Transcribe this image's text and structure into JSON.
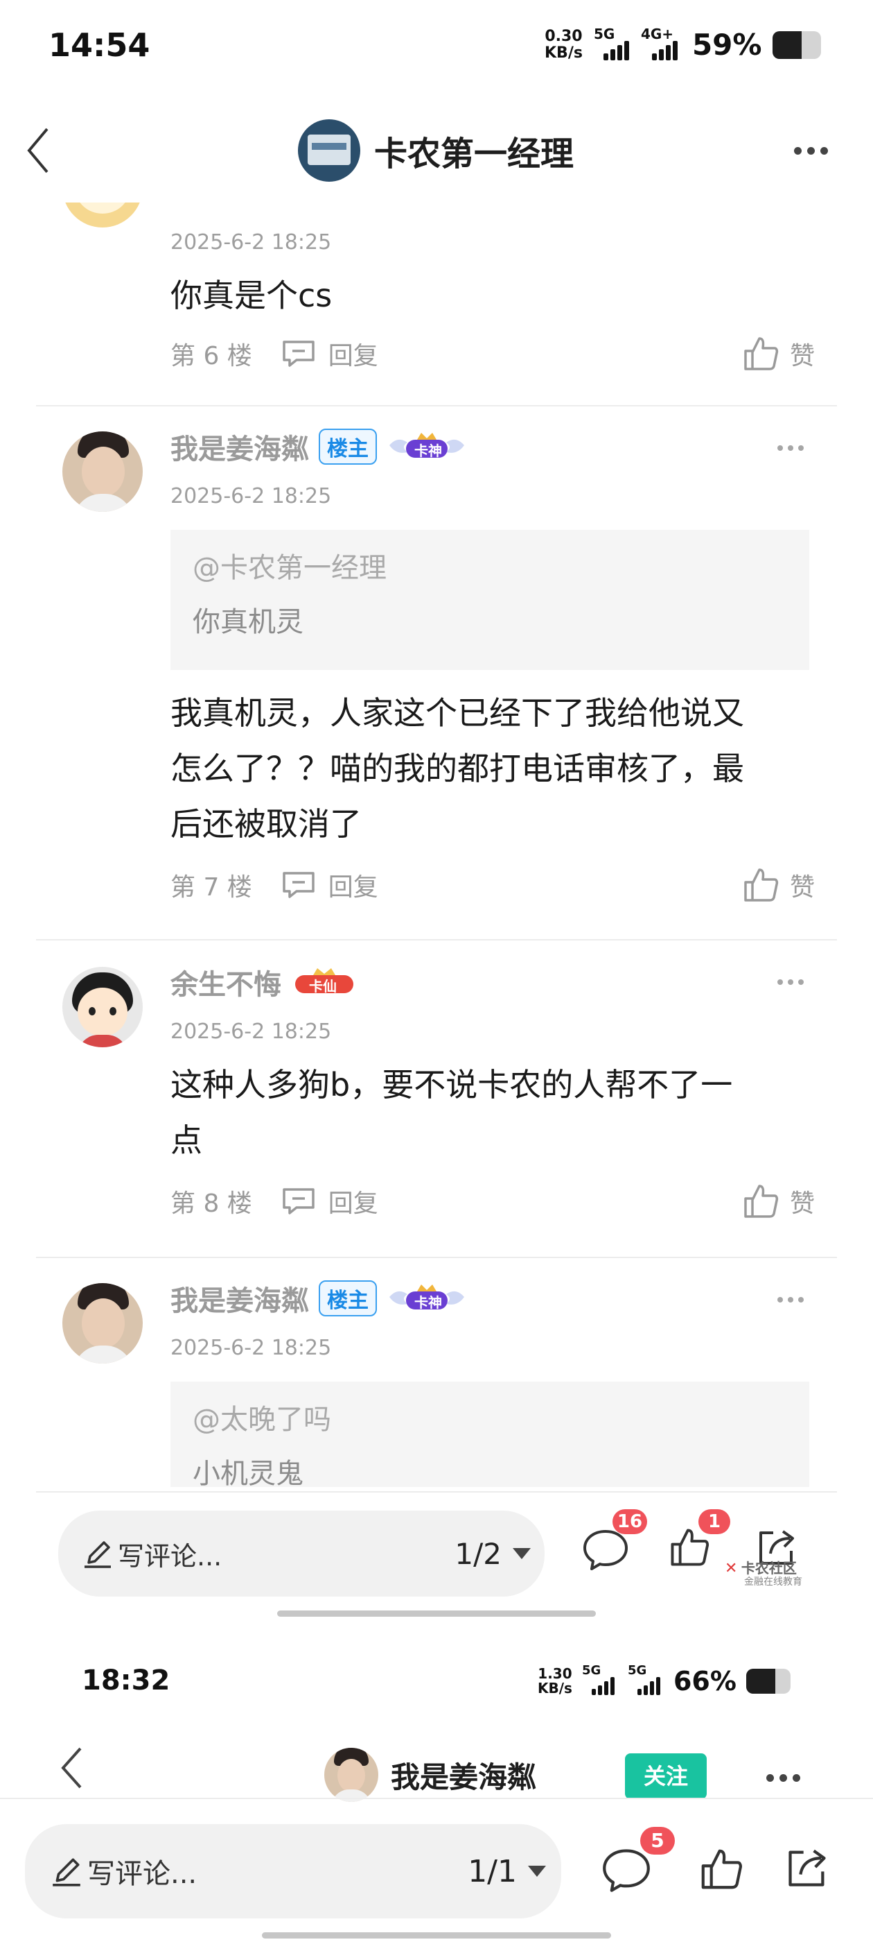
{
  "status_bar_1": {
    "time": "14:54",
    "net_speed": "0.30",
    "net_unit": "KB/s",
    "signal_1": "5G",
    "signal_2": "4G+",
    "battery": "59%",
    "battery_level": 0.59
  },
  "nav_1": {
    "title": "卡农第一经理"
  },
  "comments": [
    {
      "time": "2025-6-2 18:25",
      "body": "你真是个cs",
      "floor": "第 6 楼",
      "reply": "回复",
      "like": "赞"
    },
    {
      "name": "我是姜海粼",
      "op_badge": "楼主",
      "rank_badge": "卡神",
      "time": "2025-6-2 18:25",
      "quote_at": "@卡农第一经理",
      "quote_text": "你真机灵",
      "body_lines": [
        "我真机灵，人家这个已经下了我给他说又",
        "怎么了？？喵的我的都打电话审核了，最",
        "后还被取消了"
      ],
      "floor": "第 7 楼",
      "reply": "回复",
      "like": "赞"
    },
    {
      "name": "余生不悔",
      "rank_badge": "卡仙",
      "time": "2025-6-2 18:25",
      "body_lines": [
        "这种人多狗b，要不说卡农的人帮不了一",
        "点"
      ],
      "floor": "第 8 楼",
      "reply": "回复",
      "like": "赞"
    },
    {
      "name": "我是姜海粼",
      "op_badge": "楼主",
      "rank_badge": "卡神",
      "time": "2025-6-2 18:25",
      "quote_at": "@太晚了吗",
      "quote_text": "小机灵鬼"
    }
  ],
  "comment_bar_1": {
    "write": "写评论...",
    "page": "1/2",
    "comment_count": "16",
    "like_count": "1"
  },
  "watermark": {
    "line1": "卡农社区",
    "line2": "金融在线教育"
  },
  "status_bar_2": {
    "time": "18:32",
    "net_speed": "1.30",
    "net_unit": "KB/s",
    "signal_1": "5G",
    "signal_2": "5G",
    "battery": "66%",
    "battery_level": 0.66
  },
  "nav_2": {
    "title": "我是姜海粼",
    "follow": "关注"
  },
  "comment_bar_2": {
    "write": "写评论...",
    "page": "1/1",
    "comment_count": "5"
  },
  "colors": {
    "accent": "#19c3a0",
    "badge_red": "#f0525a",
    "op_blue": "#1a8ae6"
  }
}
